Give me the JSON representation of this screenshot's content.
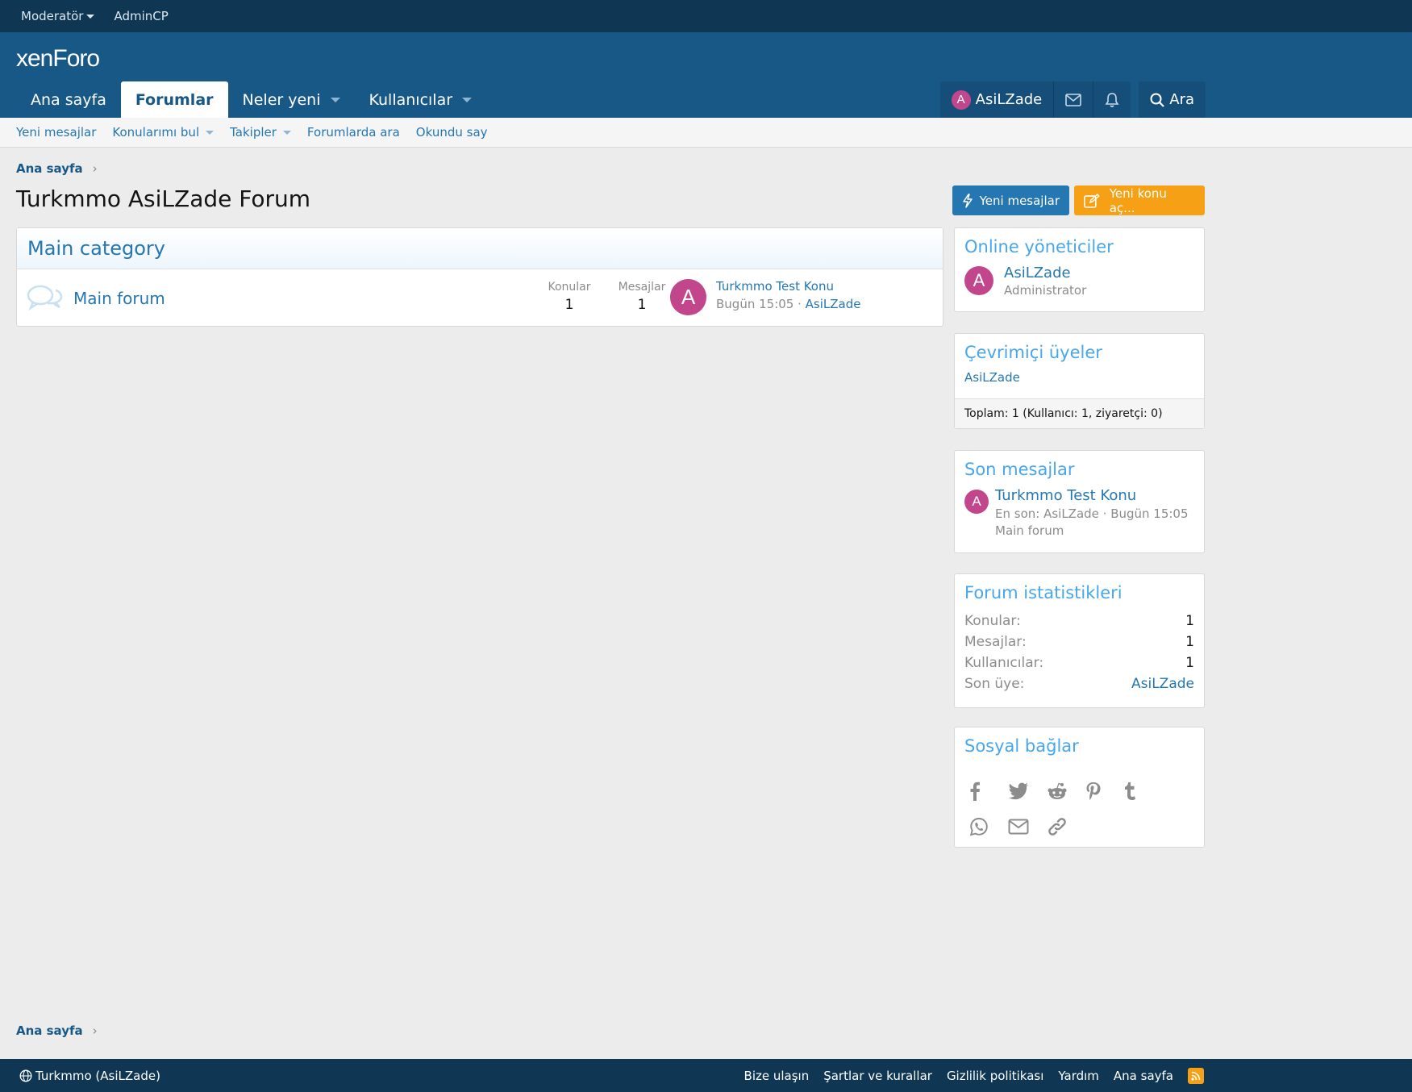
{
  "topbar": {
    "moderator": "Moderatör",
    "admincp": "AdminCP"
  },
  "logo": "xenForo",
  "nav": {
    "tabs": [
      {
        "label": "Ana sayfa"
      },
      {
        "label": "Forumlar"
      },
      {
        "label": "Neler yeni"
      },
      {
        "label": "Kullanıcılar"
      }
    ],
    "user": "AsiLZade",
    "user_initial": "A",
    "search": "Ara"
  },
  "subnav": [
    "Yeni mesajlar",
    "Konularımı bul",
    "Takipler",
    "Forumlarda ara",
    "Okundu say"
  ],
  "breadcrumb": "Ana sayfa",
  "page_title": "Turkmmo AsiLZade Forum",
  "actions": {
    "new_posts": "Yeni mesajlar",
    "new_thread": "Yeni konu aç..."
  },
  "category": {
    "title": "Main category",
    "forum": {
      "name": "Main forum",
      "threads_label": "Konular",
      "threads": "1",
      "messages_label": "Mesajlar",
      "messages": "1",
      "last_title": "Turkmmo Test Konu",
      "last_time": "Bugün 15:05",
      "last_user": "AsiLZade",
      "last_initial": "A"
    }
  },
  "online_staff": {
    "title": "Online yöneticiler",
    "name": "AsiLZade",
    "role": "Administrator",
    "initial": "A"
  },
  "online_members": {
    "title": "Çevrimiçi üyeler",
    "name": "AsiLZade",
    "total": "Toplam: 1 (Kullanıcı: 1, ziyaretçi: 0)"
  },
  "latest_posts": {
    "title": "Son mesajlar",
    "thread": "Turkmmo Test Konu",
    "meta": "En son: AsiLZade · Bugün 15:05",
    "forum": "Main forum",
    "initial": "A"
  },
  "stats": {
    "title": "Forum istatistikleri",
    "rows": [
      {
        "k": "Konular:",
        "v": "1"
      },
      {
        "k": "Mesajlar:",
        "v": "1"
      },
      {
        "k": "Kullanıcılar:",
        "v": "1"
      },
      {
        "k": "Son üye:",
        "v": "AsiLZade"
      }
    ]
  },
  "social": {
    "title": "Sosyal bağlar"
  },
  "footer": {
    "style": "Turkmmo (AsiLZade)",
    "links": [
      "Bize ulaşın",
      "Şartlar ve kurallar",
      "Gizlilik politikası",
      "Yardım",
      "Ana sayfa"
    ]
  },
  "colors": {
    "header": "#185886",
    "topbar": "#0f3652",
    "link": "#2577b1",
    "orange": "#f5a015"
  }
}
